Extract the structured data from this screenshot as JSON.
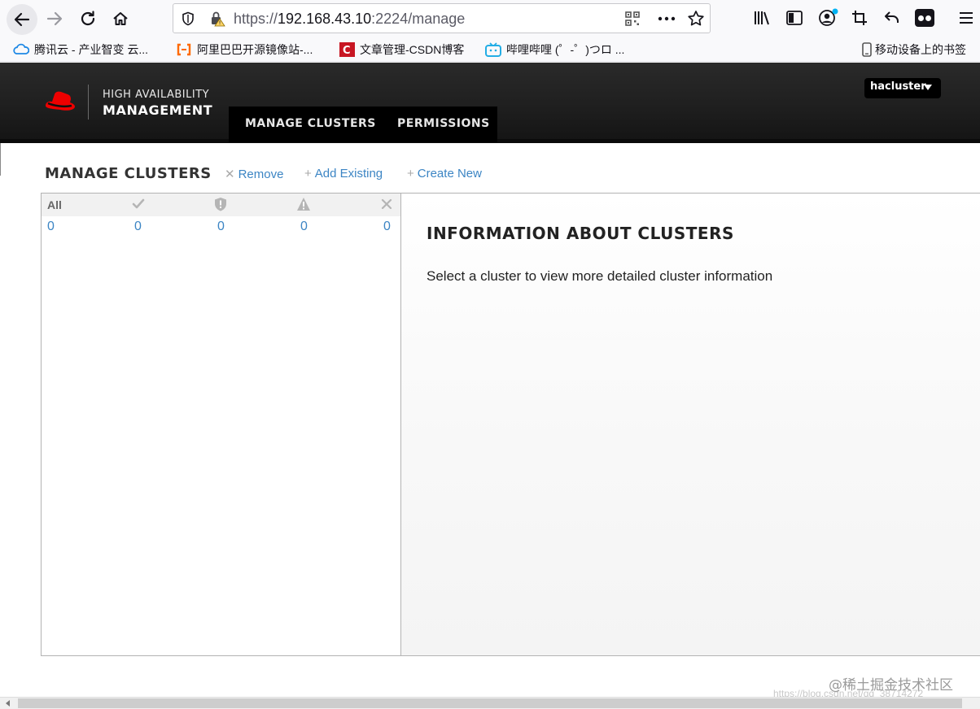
{
  "browser": {
    "url_scheme": "https://",
    "url_host": "192.168.43.10",
    "url_rest": ":2224/manage",
    "bookmarks": [
      {
        "label": "腾讯云 - 产业智变 云...",
        "icon": "tencent-cloud-icon"
      },
      {
        "label": "阿里巴巴开源镜像站-...",
        "icon": "aliyun-icon"
      },
      {
        "label": "文章管理-CSDN博客",
        "icon": "csdn-icon"
      },
      {
        "label": "哔哩哔哩 (゜-゜)つロ ...",
        "icon": "bilibili-icon"
      },
      {
        "label": "移动设备上的书签",
        "icon": "mobile-bookmarks-icon"
      }
    ]
  },
  "header": {
    "brand_line1": "HIGH AVAILABILITY",
    "brand_line2": "MANAGEMENT",
    "nav": [
      "MANAGE CLUSTERS",
      "PERMISSIONS"
    ],
    "user": "hacluster"
  },
  "main": {
    "heading": "MANAGE CLUSTERS",
    "actions": [
      "Remove",
      "Add Existing",
      "Create New"
    ],
    "filter_all_label": "All",
    "counts": [
      "0",
      "0",
      "0",
      "0",
      "0"
    ],
    "info_title": "INFORMATION ABOUT CLUSTERS",
    "info_text": "Select a cluster to view more detailed cluster information"
  },
  "watermark": "@稀土掘金技术社区",
  "watermark_faint": "https://blog.csdn.net/qq_38714272",
  "colors": {
    "link": "#3c85c4",
    "header_bg": "#1f1f1f",
    "redhat": "#e00"
  }
}
